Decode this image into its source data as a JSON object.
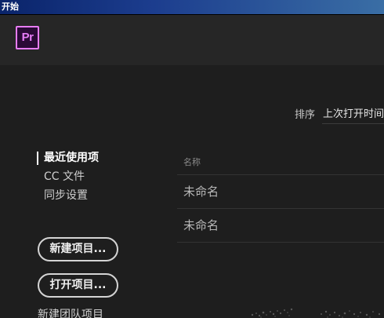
{
  "window": {
    "title": "开始"
  },
  "header": {
    "logo_text": "Pr",
    "logo_color": "#e77cf7"
  },
  "sort": {
    "label": "排序",
    "selected": "上次打开时间"
  },
  "nav": {
    "items": [
      {
        "label": "最近使用项",
        "active": true
      },
      {
        "label": "CC 文件",
        "active": false
      },
      {
        "label": "同步设置",
        "active": false
      }
    ]
  },
  "actions": {
    "new_project": "新建项目...",
    "open_project": "打开项目...",
    "new_team_project": "新建团队项目"
  },
  "recent": {
    "column_header": "名称",
    "rows": [
      "未命名",
      "未命名"
    ]
  },
  "colors": {
    "background": "#1e1e1e",
    "header": "#262626",
    "titlebar": "#0a246a"
  }
}
